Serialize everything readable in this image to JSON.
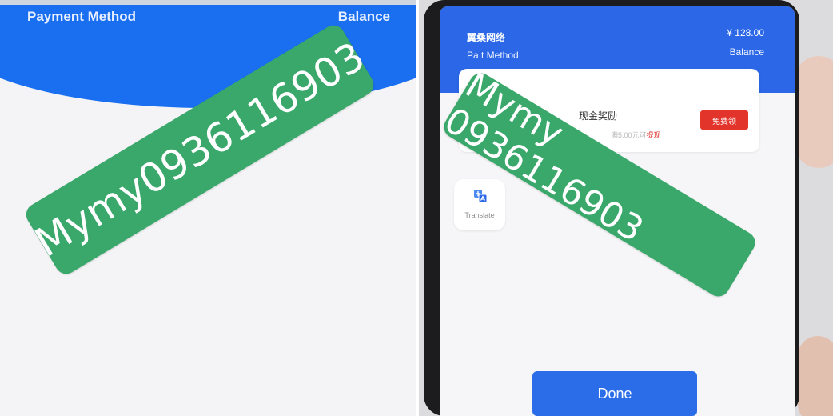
{
  "left": {
    "payment_method": "Payment Method",
    "balance": "Balance",
    "watermark": "Mymy0936116903"
  },
  "right": {
    "app_name": "翼桑网络",
    "amount": "¥ 128.00",
    "payment_method": "Pa     t Method",
    "balance": "Balance",
    "reward_title": "现金奖励",
    "reward_sub_prefix": "满5.00元可",
    "reward_sub_link": "提现",
    "claim_button": "免费领",
    "translate_label": "Translate",
    "done_button": "Done",
    "watermark": "Mymy 0936116903"
  },
  "colors": {
    "header_blue": "#1a6ff0",
    "watermark_green": "#3aa86b",
    "accent_red": "#e2342b",
    "done_blue": "#2b6de8"
  }
}
